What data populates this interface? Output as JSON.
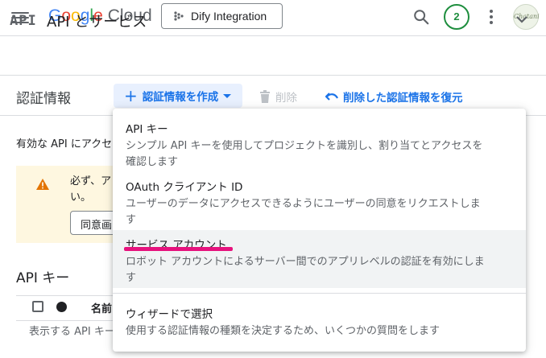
{
  "topbar": {
    "logo_google": [
      "G",
      "o",
      "o",
      "g",
      "l",
      "e"
    ],
    "logo_cloud": "Cloud",
    "project_name": "Dify Integration",
    "notifications_count": "2",
    "avatar_text": "Chatani"
  },
  "api_header": {
    "mark": "API",
    "title": "API とサービス"
  },
  "credentials": {
    "title": "認証情報",
    "create_label": "認証情報を作成",
    "delete_label": "削除",
    "restore_label": "削除した認証情報を復元"
  },
  "background": {
    "info_text": "有効な API にアクセ",
    "warning_line1": "必ず、ア",
    "warning_line2": "い。",
    "consent_button": "同意画",
    "api_keys_heading": "API キー",
    "name_header": "名前",
    "empty_text": "表示する API キー"
  },
  "menu": {
    "items": [
      {
        "title": "API キー",
        "desc1": "シンプル API キーを使用してプロジェクトを識別し、割り当てとアクセスを",
        "desc2": "確認します"
      },
      {
        "title": "OAuth クライアント ID",
        "desc1": "ユーザーのデータにアクセスできるようにユーザーの同意をリクエストしま",
        "desc2": "す"
      },
      {
        "title": "サービス アカウント",
        "desc1": "ロボット アカウントによるサーバー間でのアプリレベルの認証を有効にしま",
        "desc2": "す"
      },
      {
        "title": "ウィザードで選択",
        "desc1": "使用する認証情報の種類を決定するため、いくつかの質問をします",
        "desc2": ""
      }
    ]
  },
  "colors": {
    "accent": "#1a73e8",
    "highlight": "#e6127d",
    "badge_green": "#1e8e3e",
    "warning_bg": "#fef7e0",
    "warning_icon": "#e37400"
  },
  "icons": [
    "menu-icon",
    "dify-icon",
    "search-icon",
    "kebab-icon",
    "chevron-down-icon",
    "plus-icon",
    "trash-icon",
    "undo-icon",
    "warning-icon"
  ]
}
